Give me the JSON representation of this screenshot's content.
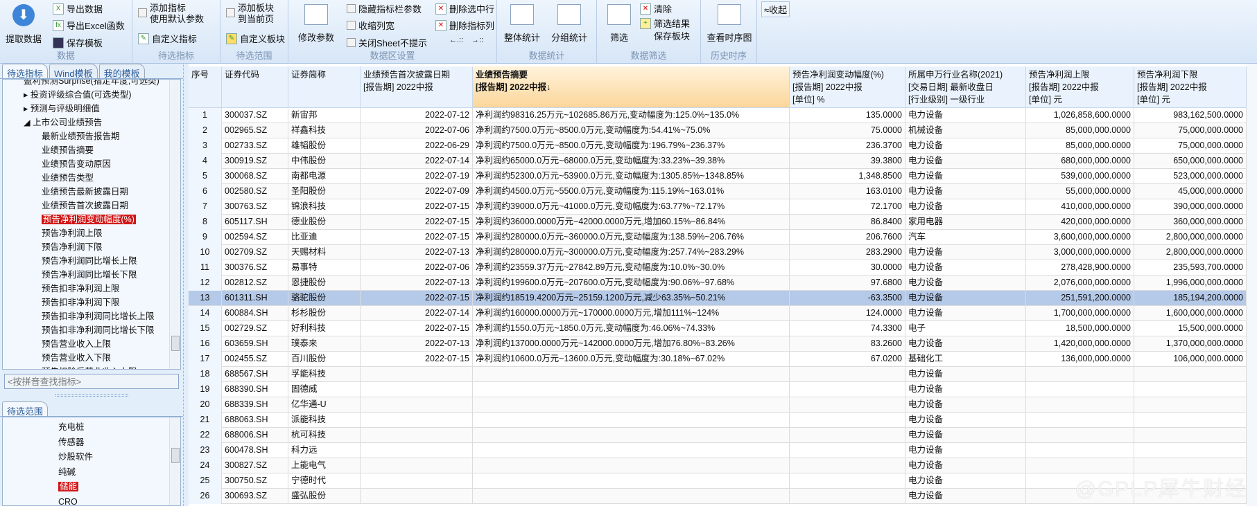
{
  "ribbon": {
    "fetch": "提取数据",
    "export_data": "导出数据",
    "export_excel": "导出Excel函数",
    "save_template": "保存模板",
    "g_data": "数据",
    "add_indicator_1": "添加指标",
    "add_indicator_2": "使用默认参数",
    "custom_indicator": "自定义指标",
    "g_indicator": "待选指标",
    "add_block_1": "添加板块",
    "add_block_2": "到当前页",
    "custom_block": "自定义板块",
    "g_range": "待选范围",
    "modify_params": "修改参数",
    "hide_bar": "隐藏指标栏参数",
    "shrink_cols": "收缩列宽",
    "close_sheet": "关闭Sheet不提示",
    "del_row": "删除选中行",
    "del_col": "删除指标列",
    "move_left": "←.::",
    "move_right": "→::",
    "g_area": "数据区设置",
    "overall_stats": "整体统计",
    "group_stats": "分组统计",
    "g_stats": "数据统计",
    "filter": "筛选",
    "clear": "清除",
    "save_filter_1": "筛选结果",
    "save_filter_2": "保存板块",
    "g_filter": "数据筛选",
    "timeseries": "查看时序图",
    "g_history": "历史时序",
    "collapse": "≈收起"
  },
  "left": {
    "tabs": [
      "待选指标",
      "Wind模板",
      "我的模板"
    ],
    "tree": [
      {
        "t": "盈利预测Surprise(指定年度,可选类)",
        "l": 1
      },
      {
        "t": "▸ 投资评级综合值(可选类型)",
        "l": 1
      },
      {
        "t": "▸ 预测与评级明细值",
        "l": 1
      },
      {
        "t": "◢ 上市公司业绩预告",
        "l": 1
      },
      {
        "t": "最新业绩预告报告期",
        "l": 2
      },
      {
        "t": "业绩预告摘要",
        "l": 2
      },
      {
        "t": "业绩预告变动原因",
        "l": 2
      },
      {
        "t": "业绩预告类型",
        "l": 2
      },
      {
        "t": "业绩预告最新披露日期",
        "l": 2
      },
      {
        "t": "业绩预告首次披露日期",
        "l": 2
      },
      {
        "t": "预告净利润变动幅度(%)",
        "l": 2,
        "sel": true
      },
      {
        "t": "预告净利润上限",
        "l": 2
      },
      {
        "t": "预告净利润下限",
        "l": 2
      },
      {
        "t": "预告净利润同比增长上限",
        "l": 2
      },
      {
        "t": "预告净利润同比增长下限",
        "l": 2
      },
      {
        "t": "预告扣非净利润上限",
        "l": 2
      },
      {
        "t": "预告扣非净利润下限",
        "l": 2
      },
      {
        "t": "预告扣非净利润同比增长上限",
        "l": 2
      },
      {
        "t": "预告扣非净利润同比增长下限",
        "l": 2
      },
      {
        "t": "预告营业收入上限",
        "l": 2
      },
      {
        "t": "预告营业收入下限",
        "l": 2
      },
      {
        "t": "预告扣除后营业收入上限",
        "l": 2
      }
    ],
    "search_placeholder": "<按拼音查找指标>",
    "range_tab": "待选范围",
    "range_tree": [
      {
        "t": "充电桩"
      },
      {
        "t": "传感器"
      },
      {
        "t": "炒股软件"
      },
      {
        "t": "纯碱"
      },
      {
        "t": "储能",
        "sel": true
      },
      {
        "t": "CRO"
      }
    ]
  },
  "grid": {
    "headers": [
      "序号",
      "证券代码",
      "证券简称",
      "业绩预告首次披露日期\n[报告期] 2022中报",
      "业绩预告摘要\n[报告期] 2022中报↓",
      "预告净利润变动幅度(%)\n[报告期] 2022中报\n[单位] %",
      "所属申万行业名称(2021)\n[交易日期] 最新收盘日\n[行业级别] 一级行业",
      "预告净利润上限\n[报告期] 2022中报\n[单位] 元",
      "预告净利润下限\n[报告期] 2022中报\n[单位] 元"
    ],
    "selected_row": 13,
    "rows": [
      [
        "1",
        "300037.SZ",
        "新宙邦",
        "2022-07-12",
        "净利润约98316.25万元~102685.86万元,变动幅度为:125.0%~135.0%",
        "135.0000",
        "电力设备",
        "1,026,858,600.0000",
        "983,162,500.0000"
      ],
      [
        "2",
        "002965.SZ",
        "祥鑫科技",
        "2022-07-06",
        "净利润约7500.0万元~8500.0万元,变动幅度为:54.41%~75.0%",
        "75.0000",
        "机械设备",
        "85,000,000.0000",
        "75,000,000.0000"
      ],
      [
        "3",
        "002733.SZ",
        "雄韬股份",
        "2022-06-29",
        "净利润约7500.0万元~8500.0万元,变动幅度为:196.79%~236.37%",
        "236.3700",
        "电力设备",
        "85,000,000.0000",
        "75,000,000.0000"
      ],
      [
        "4",
        "300919.SZ",
        "中伟股份",
        "2022-07-14",
        "净利润约65000.0万元~68000.0万元,变动幅度为:33.23%~39.38%",
        "39.3800",
        "电力设备",
        "680,000,000.0000",
        "650,000,000.0000"
      ],
      [
        "5",
        "300068.SZ",
        "南都电源",
        "2022-07-19",
        "净利润约52300.0万元~53900.0万元,变动幅度为:1305.85%~1348.85%",
        "1,348.8500",
        "电力设备",
        "539,000,000.0000",
        "523,000,000.0000"
      ],
      [
        "6",
        "002580.SZ",
        "圣阳股份",
        "2022-07-09",
        "净利润约4500.0万元~5500.0万元,变动幅度为:115.19%~163.01%",
        "163.0100",
        "电力设备",
        "55,000,000.0000",
        "45,000,000.0000"
      ],
      [
        "7",
        "300763.SZ",
        "锦浪科技",
        "2022-07-15",
        "净利润约39000.0万元~41000.0万元,变动幅度为:63.77%~72.17%",
        "72.1700",
        "电力设备",
        "410,000,000.0000",
        "390,000,000.0000"
      ],
      [
        "8",
        "605117.SH",
        "德业股份",
        "2022-07-15",
        "净利润约36000.0000万元~42000.0000万元,增加60.15%~86.84%",
        "86.8400",
        "家用电器",
        "420,000,000.0000",
        "360,000,000.0000"
      ],
      [
        "9",
        "002594.SZ",
        "比亚迪",
        "2022-07-15",
        "净利润约280000.0万元~360000.0万元,变动幅度为:138.59%~206.76%",
        "206.7600",
        "汽车",
        "3,600,000,000.0000",
        "2,800,000,000.0000"
      ],
      [
        "10",
        "002709.SZ",
        "天赐材料",
        "2022-07-13",
        "净利润约280000.0万元~300000.0万元,变动幅度为:257.74%~283.29%",
        "283.2900",
        "电力设备",
        "3,000,000,000.0000",
        "2,800,000,000.0000"
      ],
      [
        "11",
        "300376.SZ",
        "易事特",
        "2022-07-06",
        "净利润约23559.37万元~27842.89万元,变动幅度为:10.0%~30.0%",
        "30.0000",
        "电力设备",
        "278,428,900.0000",
        "235,593,700.0000"
      ],
      [
        "12",
        "002812.SZ",
        "恩捷股份",
        "2022-07-13",
        "净利润约199600.0万元~207600.0万元,变动幅度为:90.06%~97.68%",
        "97.6800",
        "电力设备",
        "2,076,000,000.0000",
        "1,996,000,000.0000"
      ],
      [
        "13",
        "601311.SH",
        "骆驼股份",
        "2022-07-15",
        "净利润约18519.4200万元~25159.1200万元,减少63.35%~50.21%",
        "-63.3500",
        "电力设备",
        "251,591,200.0000",
        "185,194,200.0000"
      ],
      [
        "14",
        "600884.SH",
        "杉杉股份",
        "2022-07-14",
        "净利润约160000.0000万元~170000.0000万元,增加111%~124%",
        "124.0000",
        "电力设备",
        "1,700,000,000.0000",
        "1,600,000,000.0000"
      ],
      [
        "15",
        "002729.SZ",
        "好利科技",
        "2022-07-15",
        "净利润约1550.0万元~1850.0万元,变动幅度为:46.06%~74.33%",
        "74.3300",
        "电子",
        "18,500,000.0000",
        "15,500,000.0000"
      ],
      [
        "16",
        "603659.SH",
        "璞泰来",
        "2022-07-13",
        "净利润约137000.0000万元~142000.0000万元,增加76.80%~83.26%",
        "83.2600",
        "电力设备",
        "1,420,000,000.0000",
        "1,370,000,000.0000"
      ],
      [
        "17",
        "002455.SZ",
        "百川股份",
        "2022-07-15",
        "净利润约10600.0万元~13600.0万元,变动幅度为:30.18%~67.02%",
        "67.0200",
        "基础化工",
        "136,000,000.0000",
        "106,000,000.0000"
      ],
      [
        "18",
        "688567.SH",
        "孚能科技",
        "",
        "",
        "",
        "电力设备",
        "",
        ""
      ],
      [
        "19",
        "688390.SH",
        "固德威",
        "",
        "",
        "",
        "电力设备",
        "",
        ""
      ],
      [
        "20",
        "688339.SH",
        "亿华通-U",
        "",
        "",
        "",
        "电力设备",
        "",
        ""
      ],
      [
        "21",
        "688063.SH",
        "派能科技",
        "",
        "",
        "",
        "电力设备",
        "",
        ""
      ],
      [
        "22",
        "688006.SH",
        "杭可科技",
        "",
        "",
        "",
        "电力设备",
        "",
        ""
      ],
      [
        "23",
        "600478.SH",
        "科力远",
        "",
        "",
        "",
        "电力设备",
        "",
        ""
      ],
      [
        "24",
        "300827.SZ",
        "上能电气",
        "",
        "",
        "",
        "电力设备",
        "",
        ""
      ],
      [
        "25",
        "300750.SZ",
        "宁德时代",
        "",
        "",
        "",
        "电力设备",
        "",
        ""
      ],
      [
        "26",
        "300693.SZ",
        "盛弘股份",
        "",
        "",
        "",
        "电力设备",
        "",
        ""
      ]
    ]
  },
  "watermark": "@GPLP犀牛财经"
}
